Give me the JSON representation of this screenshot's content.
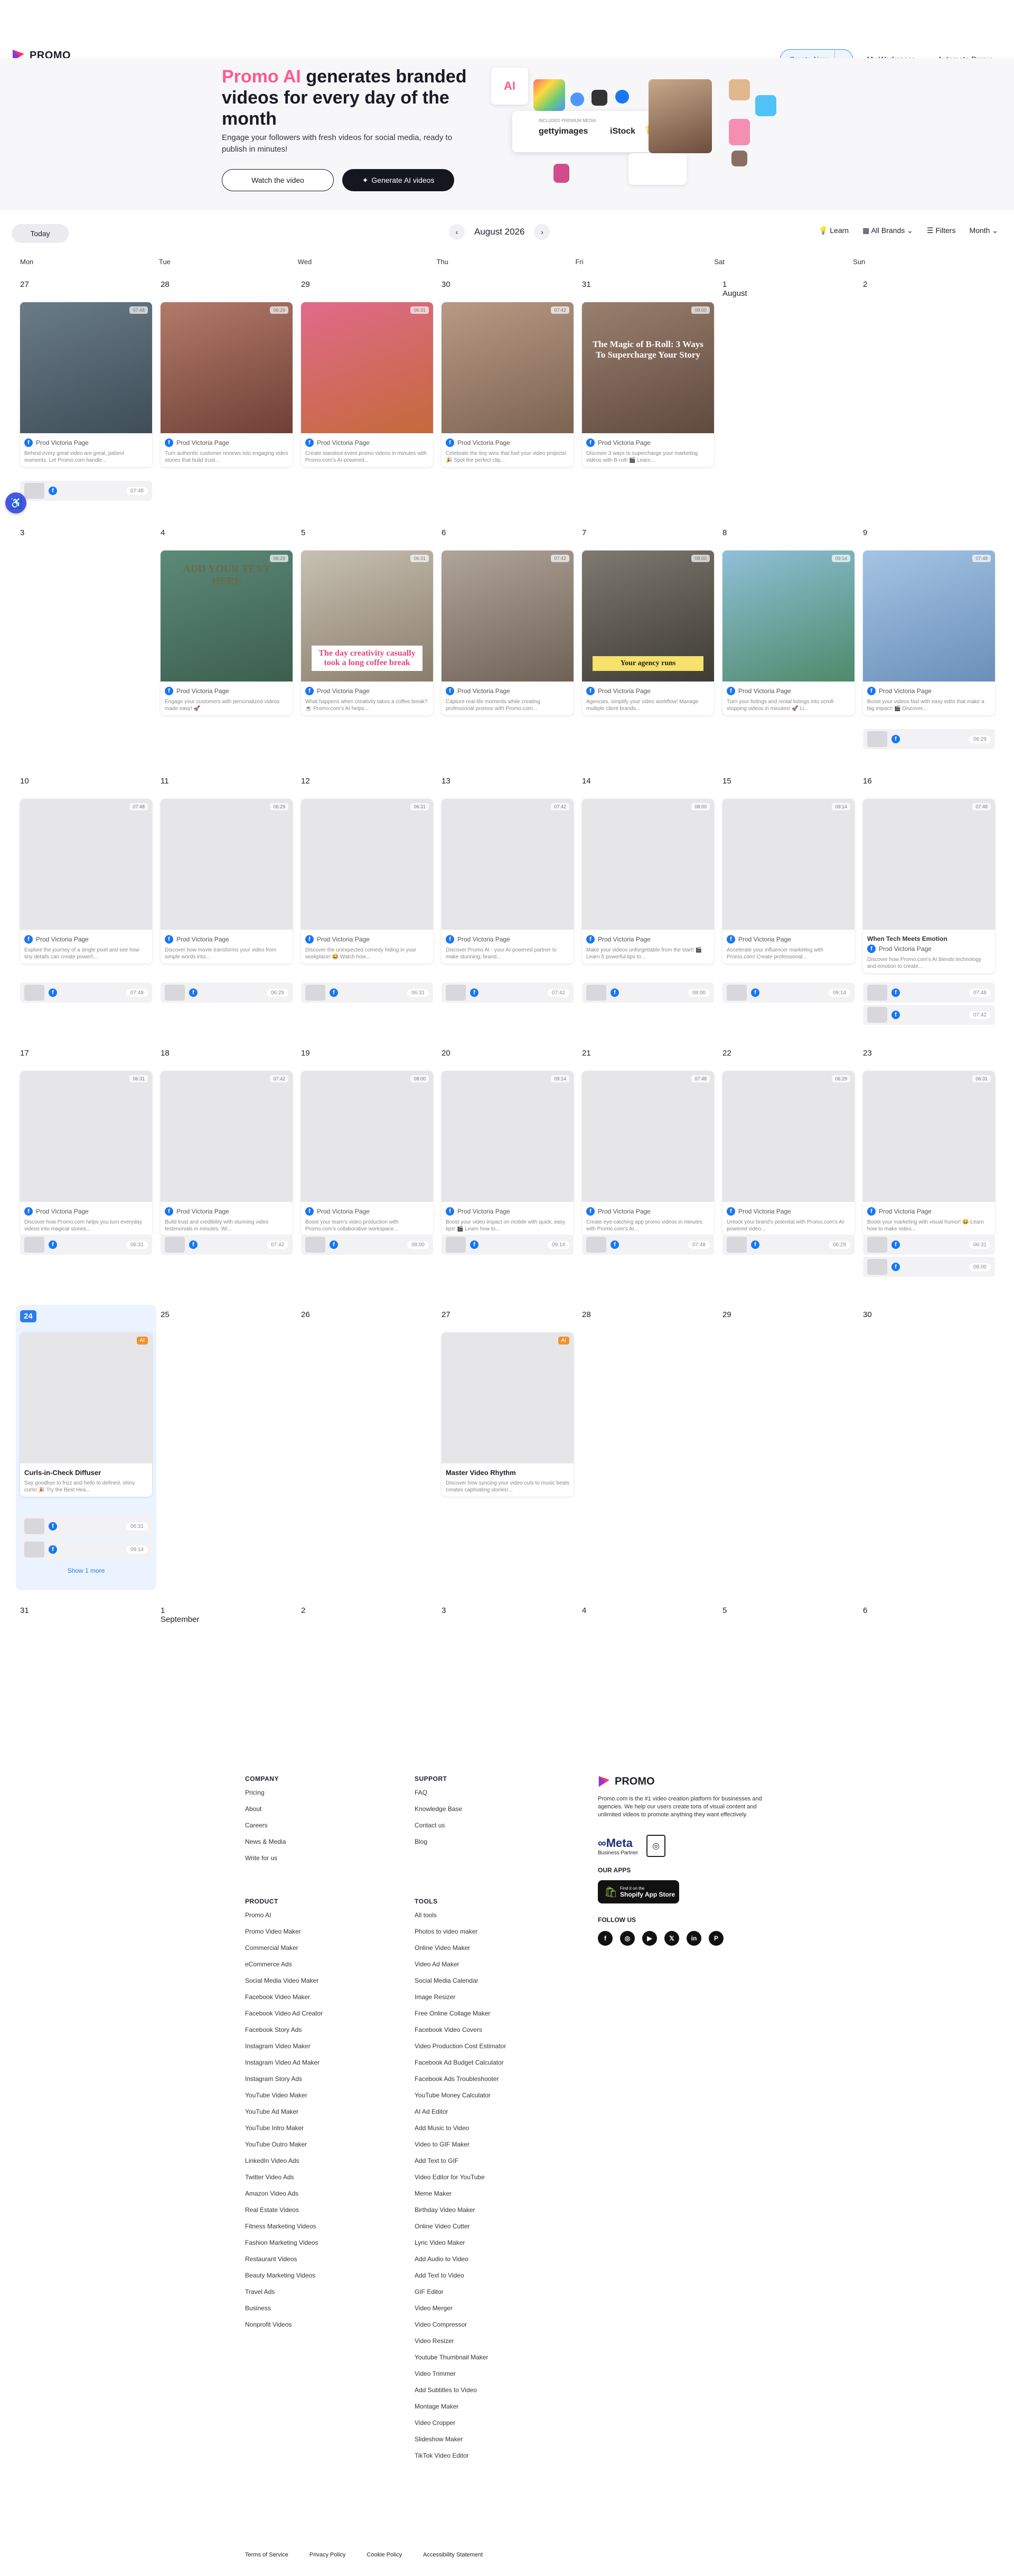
{
  "nav": {
    "logo": "PROMO",
    "create": "Create New",
    "workspace": "My Workspace",
    "automate": "Automate Promo"
  },
  "hero": {
    "title_pink": "Promo AI",
    "title_rest": " generates branded videos for every day of the month",
    "subtitle": "Engage your followers with fresh videos for social media, ready to publish in minutes!",
    "watch": "Watch the video",
    "generate": "Generate AI videos",
    "getty": "gettyimages",
    "istock": "iStock",
    "included": "INCLUDED PREMIUM MEDIA"
  },
  "toolbar": {
    "today": "Today",
    "month": "August 2026",
    "learn": "Learn",
    "brands": "All Brands",
    "filters": "Filters",
    "view": "Month"
  },
  "weekdays": [
    "Mon",
    "Tue",
    "Wed",
    "Thu",
    "Fri",
    "Sat",
    "Sun"
  ],
  "account": "Prod Victoria Page",
  "weeks": [
    {
      "days": [
        "27",
        "28",
        "29",
        "30",
        "31",
        "1 August",
        "2"
      ]
    },
    {
      "days": [
        "3",
        "4",
        "5",
        "6",
        "7",
        "8",
        "9"
      ]
    },
    {
      "days": [
        "10",
        "11",
        "12",
        "13",
        "14",
        "15",
        "16"
      ]
    },
    {
      "days": [
        "17",
        "18",
        "19",
        "20",
        "21",
        "22",
        "23"
      ]
    },
    {
      "days": [
        "24",
        "25",
        "26",
        "27",
        "28",
        "29",
        "30"
      ]
    },
    {
      "days": [
        "31",
        "1 September",
        "2",
        "3",
        "4",
        "5",
        "6"
      ]
    }
  ],
  "week1_desc": [
    "Behind every great video are great, patient moments. Let Promo.com handle...",
    "Turn authentic customer reviews into engaging video stories that build trust...",
    "Create standout event promo videos in minutes with Promo.com's AI-powered...",
    "Celebrate the tiny wins that fuel your video projects! 🎉 Spot the perfect clip...",
    "Discover 3 ways to supercharge your marketing videos with B-roll! 🎬 Learn..."
  ],
  "week2_desc": [
    "Engage your customers with personalized videos made easy! 🚀",
    "What happens when creativity takes a coffee break? ☕ Promo.com's AI helps...",
    "Capture real-life moments while creating professional promos with Promo.com...",
    "Agencies, simplify your video workflow! Manage multiple client brands...",
    "Turn your listings and rental listings into scroll-stopping videos in minutes! 🚀 Li...",
    "Boost your videos fast with easy edits that make a big impact! 🎬 Discover..."
  ],
  "week3_desc": [
    "Explore the journey of a single pixel and see how tiny details can create powerf...",
    "Discover how movie transforms your video from simple words into...",
    "Discover the unexpected comedy hiding in your workplace! 😂 Watch how...",
    "Discover Promo AI - your AI-powered partner to make stunning, brand...",
    "Make your videos unforgettable from the start! 🎬 Learn 5 powerful tips to...",
    "Accelerate your influencer marketing with Promo.com! Create professional...",
    "Discover how Promo.com's AI blends technology and emotion to create..."
  ],
  "week4_desc": [
    "Discover how Promo.com helps you turn everyday videos into magical stories...",
    "Build trust and credibility with stunning video testimonials in minutes. Wi...",
    "Boost your team's video production with Promo.com's collaborative workspace...",
    "Boost your video impact on mobile with quick, easy tips! 🎬 Learn how to...",
    "Create eye-catching app promo videos in minutes with Promo.com's AI...",
    "Unlock your brand's potential with Promo.com's AI-powered video...",
    "Boost your marketing with visual humor! 😂 Learn how to make video..."
  ],
  "week3_sun_title": "When Tech Meets Emotion",
  "card_b1": {
    "title": "Curls-in-Check Diffuser",
    "desc": "Say goodbye to frizz and hello to defined, shiny curls! 🎉 Try the Best Hea...",
    "show": "Show 1 more",
    "ai": "AI"
  },
  "card_b2": {
    "title": "Master Video Rhythm",
    "desc": "Discover how syncing your video cuts to music beats creates captivating stories!..."
  },
  "times": [
    "07:48",
    "06:29",
    "06:31",
    "07:42",
    "08:00",
    "09:14"
  ],
  "thumb_text": {
    "t1": "The Magic of B-Roll: 3 Ways To Supercharge Your Story",
    "t2": "The day creativity casually took a long coffee break",
    "t3": "Your agency runs",
    "t4": "ADD YOUR TEXT HERE"
  },
  "footer": {
    "company_h": "COMPANY",
    "company": [
      "Pricing",
      "About",
      "Careers",
      "News & Media",
      "Write for us"
    ],
    "support_h": "SUPPORT",
    "support": [
      "FAQ",
      "Knowledge Base",
      "Contact us",
      "Blog"
    ],
    "product_h": "PRODUCT",
    "product": [
      "Promo AI",
      "Promo Video Maker",
      "Commercial Maker",
      "eCommerce Ads",
      "Social Media Video Maker",
      "Facebook Video Maker",
      "Facebook Video Ad Creator",
      "Facebook Story Ads",
      "Instagram Video Maker",
      "Instagram Video Ad Maker",
      "Instagram Story Ads",
      "YouTube Video Maker",
      "YouTube Ad Maker",
      "YouTube Intro Maker",
      "YouTube Outro Maker",
      "LinkedIn Video Ads",
      "Twitter Video Ads",
      "Amazon Video Ads",
      "Real Estate Videos",
      "Fitness Marketing Videos",
      "Fashion Marketing Videos",
      "Restaurant Videos",
      "Beauty Marketing Videos",
      "Travel Ads",
      "Business",
      "Nonprofit Videos"
    ],
    "tools_h": "TOOLS",
    "tools": [
      "All tools",
      "Photos to video maker",
      "Online Video Maker",
      "Video Ad Maker",
      "Social Media Calendar",
      "Image Resizer",
      "Free Online Collage Maker",
      "Facebook Video Covers",
      "Video Production Cost Estimator",
      "Facebook Ad Budget Calculator",
      "Facebook Ads Troubleshooter",
      "YouTube Money Calculator",
      "AI Ad Editor",
      "Add Music to Video",
      "Video to GIF Maker",
      "Add Text to GIF",
      "Video Editor for YouTube",
      "Meme Maker",
      "Birthday Video Maker",
      "Online Video Cutter",
      "Lyric Video Maker",
      "Add Audio to Video",
      "Add Text to Video",
      "GIF Editor",
      "Video Merger",
      "Video Compressor",
      "Video Resizer",
      "Youtube Thumbnail Maker",
      "Video Trimmer",
      "Add Subtitles to Video",
      "Montage Maker",
      "Video Cropper",
      "Slideshow Maker",
      "TikTok Video Editor"
    ],
    "about": "Promo.com is the #1 video creation platform for businesses and agencies. We help our users create tons of visual content and unlimited videos to promote anything they want effectively.",
    "meta": "Meta",
    "meta_sub": "Business Partner",
    "apps_h": "OUR APPS",
    "shopify": "Shopify App Store",
    "shopify_sub": "Find it on the",
    "follow_h": "FOLLOW US",
    "legal": [
      "Terms of Service",
      "Privacy Policy",
      "Cookie Policy",
      "Accessibility Statement"
    ]
  },
  "colors": {
    "accent": "#1f6fe6",
    "pink": "#ff5a8a",
    "fb": "#1877f2",
    "today": "#2b7de9",
    "ai": "#f0932b"
  }
}
